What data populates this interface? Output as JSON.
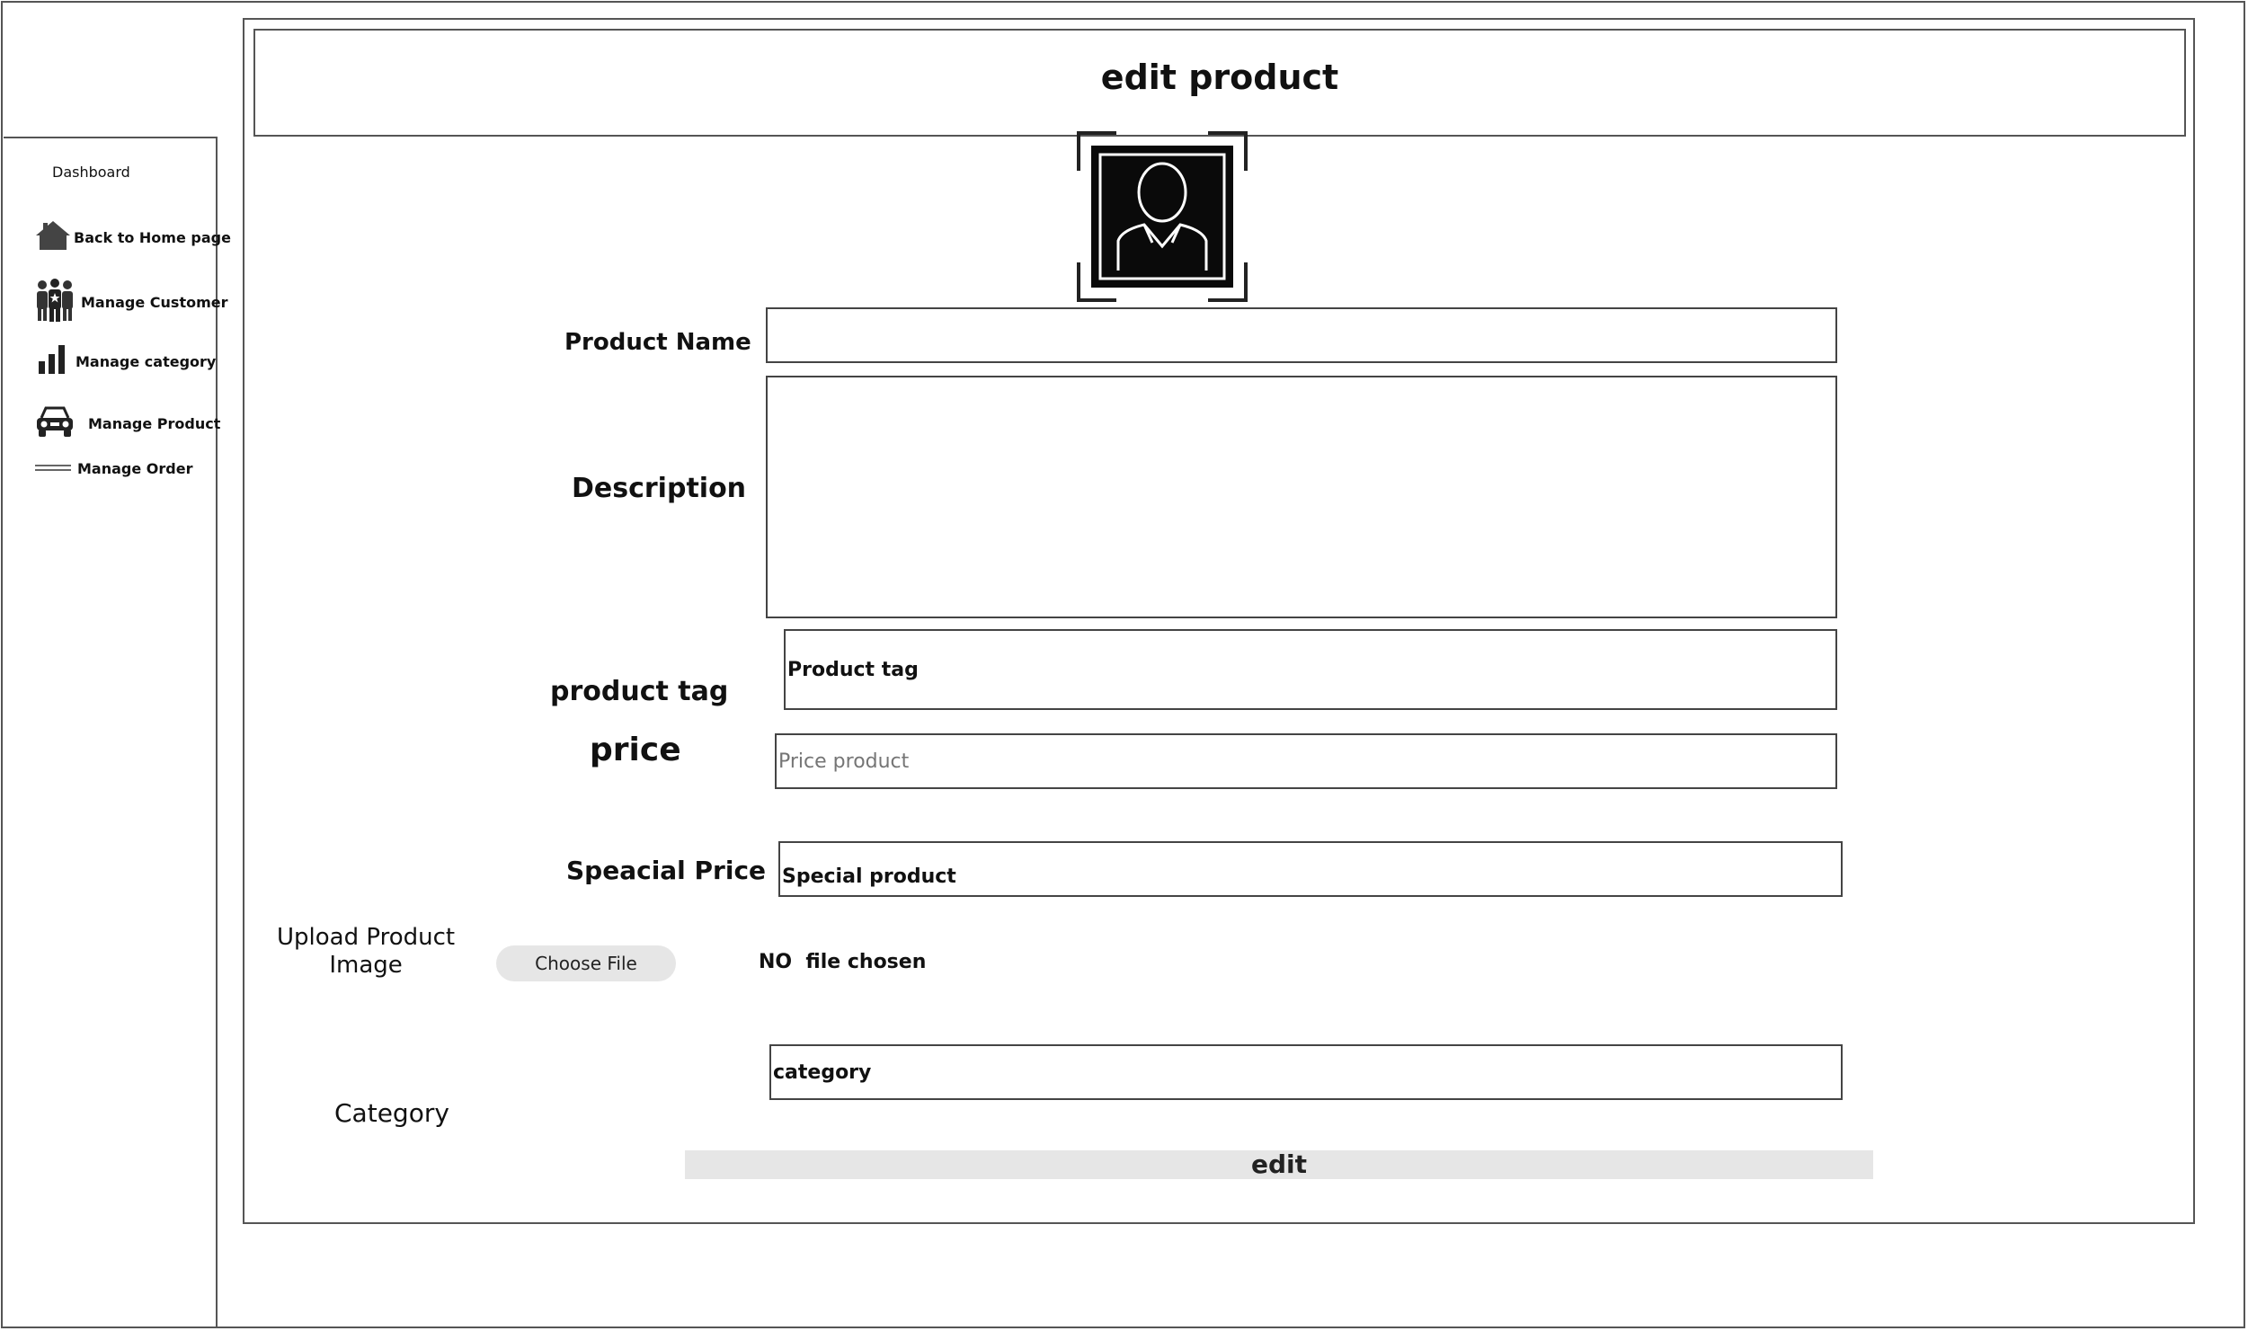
{
  "header": {
    "title": "edit product"
  },
  "sidebar": {
    "title": "Dashboard",
    "items": [
      {
        "label": "Back to Home page",
        "icon": "home-icon"
      },
      {
        "label": "Manage Customer",
        "icon": "users-icon"
      },
      {
        "label": "Manage category",
        "icon": "bar-chart-icon"
      },
      {
        "label": "Manage Product",
        "icon": "car-icon"
      },
      {
        "label": "Manage Order",
        "icon": "lines-icon"
      }
    ]
  },
  "form": {
    "avatar_icon": "user-portrait-icon",
    "product_name": {
      "label": "Product Name",
      "value": ""
    },
    "description": {
      "label": "Description",
      "value": ""
    },
    "product_tag": {
      "label": "product tag",
      "value": "Product tag"
    },
    "price": {
      "label": "price",
      "placeholder": "Price product"
    },
    "special_price": {
      "label": "Speacial Price",
      "value": "Special product"
    },
    "upload": {
      "label_line1": "Upload Product",
      "label_line2": "Image",
      "button_label": "Choose File",
      "status": "NO  file chosen"
    },
    "category": {
      "label": "Category",
      "value": "category"
    },
    "submit_label": "edit"
  }
}
